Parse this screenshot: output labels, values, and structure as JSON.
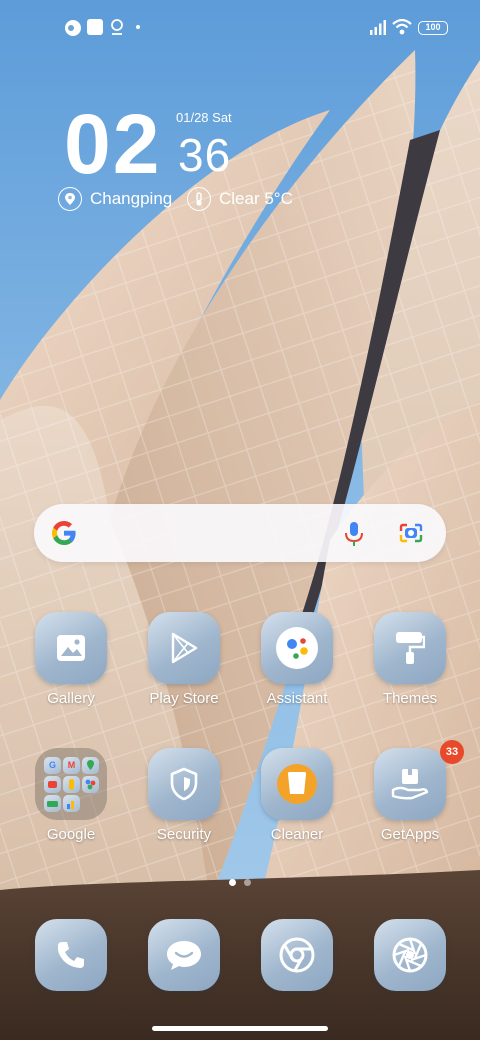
{
  "status_bar": {
    "battery_level": "100",
    "left_icons": [
      "app-notification-icon",
      "square-notification-icon",
      "location-notification-icon",
      "more-dot-icon"
    ],
    "right_icons": [
      "signal-icon",
      "wifi-icon",
      "battery-icon"
    ]
  },
  "clock": {
    "hours": "02",
    "minutes": "36",
    "date": "01/28 Sat",
    "location": "Changping",
    "weather": "Clear 5°C",
    "location_icon": "location-pin-icon",
    "weather_icon": "thermometer-icon"
  },
  "search": {
    "icons": [
      "google-g-icon",
      "microphone-icon",
      "google-lens-icon"
    ]
  },
  "apps": [
    {
      "label": "Gallery",
      "icon": "gallery-icon"
    },
    {
      "label": "Play Store",
      "icon": "play-store-icon"
    },
    {
      "label": "Assistant",
      "icon": "assistant-icon"
    },
    {
      "label": "Themes",
      "icon": "paint-roller-icon"
    },
    {
      "label": "Google",
      "icon": "folder-icon"
    },
    {
      "label": "Security",
      "icon": "shield-icon"
    },
    {
      "label": "Cleaner",
      "icon": "trash-can-icon"
    },
    {
      "label": "GetApps",
      "icon": "box-hand-icon",
      "badge": "33"
    }
  ],
  "google_folder_letters": [
    "G",
    "M"
  ],
  "pager": {
    "current_page": 1,
    "page_count": 2
  },
  "dock": [
    {
      "icon": "phone-icon"
    },
    {
      "icon": "messaging-icon"
    },
    {
      "icon": "chrome-icon"
    },
    {
      "icon": "camera-aperture-icon"
    }
  ],
  "colors": {
    "sky": "#5d9cd9",
    "building": "#e0c7b1",
    "badge": "#e8492a",
    "icon_tile": "#a8bdd2",
    "icon_glyph": "#ffffff"
  }
}
